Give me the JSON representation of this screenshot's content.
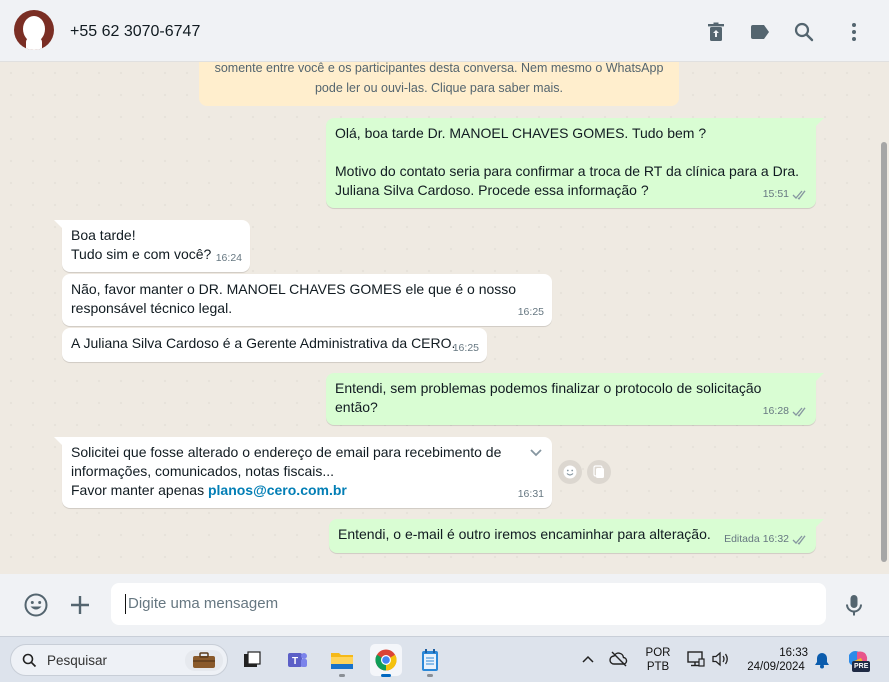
{
  "header": {
    "contact": "+55 62 3070-6747",
    "icons": [
      "archive-icon",
      "label-icon",
      "search-icon",
      "menu-icon"
    ]
  },
  "encryption": {
    "line1": "somente entre você e os participantes desta conversa. Nem mesmo o WhatsApp",
    "line2": "pode ler ou ouvi-las. Clique para saber mais."
  },
  "messages": [
    {
      "dir": "out",
      "lines": [
        "Olá, boa tarde Dr. MANOEL CHAVES GOMES. Tudo bem ?",
        "",
        "Motivo do contato seria para confirmar a troca de RT da clínica para a Dra.",
        "Juliana Silva Cardoso. Procede essa informação ?"
      ],
      "time": "15:51"
    },
    {
      "dir": "in",
      "lines": [
        "Boa tarde!",
        "Tudo sim e com você?"
      ],
      "time": "16:24"
    },
    {
      "dir": "in",
      "lines": [
        "Não, favor manter o  DR. MANOEL CHAVES GOMES ele que é o nosso",
        "responsável técnico legal."
      ],
      "time": "16:25"
    },
    {
      "dir": "in",
      "lines": [
        "A Juliana Silva Cardoso é a Gerente Administrativa da CERO."
      ],
      "time": "16:25"
    },
    {
      "dir": "out",
      "lines": [
        "Entendi, sem problemas podemos finalizar o protocolo de solicitação",
        "então?"
      ],
      "time": "16:28"
    },
    {
      "dir": "in",
      "lines": [
        "Solicitei que fosse alterado o endereço de email para recebimento de",
        "informações, comunicados, notas fiscais..."
      ],
      "prefix": "Favor manter apenas ",
      "link": "planos@cero.com.br",
      "time": "16:31"
    },
    {
      "dir": "out",
      "lines": [
        "Entendi, o e-mail é outro iremos encaminhar para alteração."
      ],
      "edited": "Editada",
      "time": "16:32"
    }
  ],
  "composer": {
    "placeholder": "Digite uma mensagem",
    "icons": [
      "emoji-icon",
      "plus-icon",
      "mic-icon"
    ]
  },
  "taskbar": {
    "search_label": "Pesquisar",
    "lang_top": "POR",
    "lang_bottom": "PTB",
    "time": "16:33",
    "date": "24/09/2024",
    "badge": "PRE"
  },
  "colors": {
    "outgoing_bubble": "#d9fdd3",
    "incoming_bubble": "#ffffff",
    "link": "#027eb5",
    "avatar": "#7a2e24"
  }
}
